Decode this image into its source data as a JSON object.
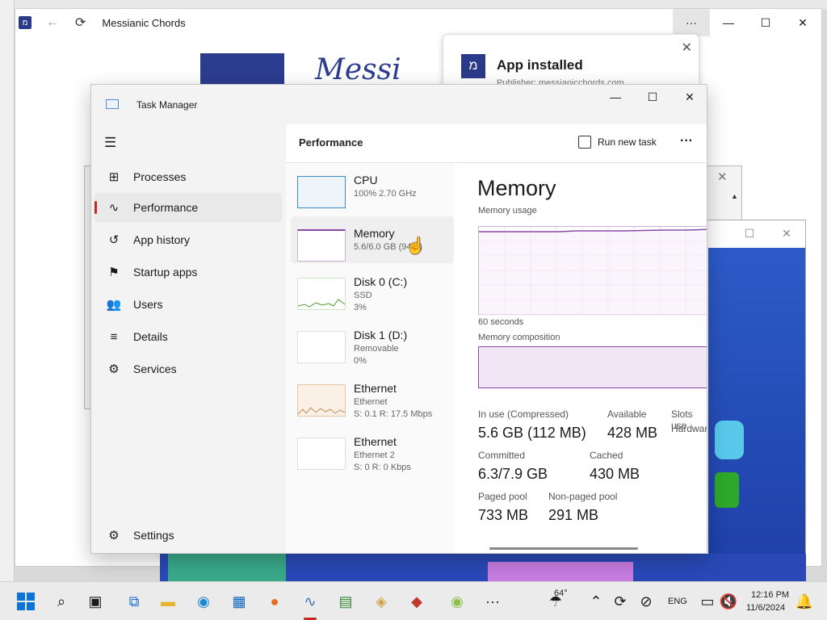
{
  "app_window": {
    "title": "Messianic Chords",
    "more_label": "···",
    "minimize": "—",
    "maximize": "☐",
    "close": "✕",
    "logo_glyph": "מ",
    "hero_text": "Messi"
  },
  "toast": {
    "title": "App installed",
    "subtitle": "Publisher: messianicchords.com",
    "icon_glyph": "מ",
    "close": "✕"
  },
  "task_manager": {
    "title": "Task Manager",
    "controls": {
      "minimize": "—",
      "maximize": "☐",
      "close": "✕"
    },
    "nav": [
      {
        "label": "Processes",
        "icon": "⊞"
      },
      {
        "label": "Performance",
        "icon": "∿"
      },
      {
        "label": "App history",
        "icon": "↺"
      },
      {
        "label": "Startup apps",
        "icon": "⚑"
      },
      {
        "label": "Users",
        "icon": "👥"
      },
      {
        "label": "Details",
        "icon": "≡"
      },
      {
        "label": "Services",
        "icon": "⚙"
      }
    ],
    "settings_label": "Settings",
    "header": "Performance",
    "run_new_task": "Run new task",
    "more": "···",
    "resources": [
      {
        "name": "CPU",
        "line2": "100% 2.70 GHz",
        "line3": ""
      },
      {
        "name": "Memory",
        "line2": "5.6/6.0 GB (94%)",
        "line3": ""
      },
      {
        "name": "Disk 0 (C:)",
        "line2": "SSD",
        "line3": "3%"
      },
      {
        "name": "Disk 1 (D:)",
        "line2": "Removable",
        "line3": "0%"
      },
      {
        "name": "Ethernet",
        "line2": "Ethernet",
        "line3": "S: 0.1 R: 17.5 Mbps"
      },
      {
        "name": "Ethernet",
        "line2": "Ethernet 2",
        "line3": "S: 0 R: 0 Kbps"
      }
    ],
    "memory": {
      "title": "Memory",
      "usage_label": "Memory usage",
      "seconds_label": "60 seconds",
      "composition_label": "Memory composition",
      "stats": {
        "in_use_label": "In use (Compressed)",
        "in_use_value": "5.6 GB (112 MB)",
        "available_label": "Available",
        "available_value": "428 MB",
        "slots_label": "Slots use",
        "hardware_label": "Hardwar",
        "committed_label": "Committed",
        "committed_value": "6.3/7.9 GB",
        "cached_label": "Cached",
        "cached_value": "430 MB",
        "paged_label": "Paged pool",
        "paged_value": "733 MB",
        "nonpaged_label": "Non-paged pool",
        "nonpaged_value": "291 MB"
      }
    }
  },
  "taskbar": {
    "weather": "64°",
    "language": "ENG",
    "time": "12:16 PM",
    "date": "11/6/2024"
  }
}
